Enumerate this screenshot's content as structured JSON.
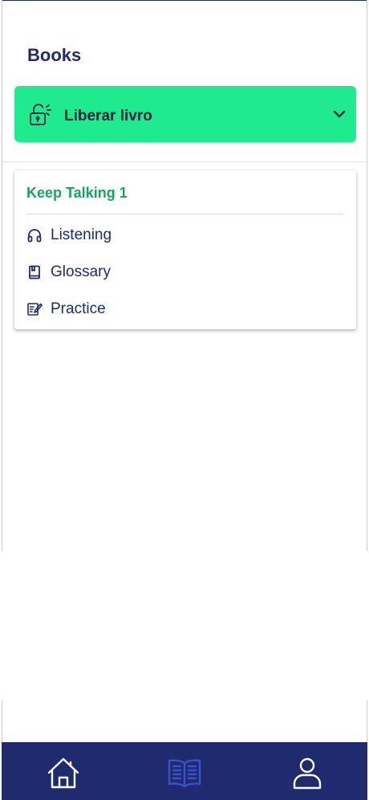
{
  "page": {
    "title": "Books"
  },
  "unlock": {
    "label": "Liberar livro",
    "icon": "unlock-icon",
    "expand_icon": "chevron-down-icon",
    "background": "#1eeb8e"
  },
  "book": {
    "title": "Keep Talking 1",
    "title_color": "#14a85e",
    "items": [
      {
        "label": "Listening",
        "icon": "headphones-icon"
      },
      {
        "label": "Glossary",
        "icon": "book-icon"
      },
      {
        "label": "Practice",
        "icon": "edit-icon"
      }
    ]
  },
  "bottom_nav": {
    "background": "#1f2b6e",
    "items": [
      {
        "name": "home",
        "icon": "home-icon",
        "active": false
      },
      {
        "name": "books",
        "icon": "open-book-icon",
        "active": true
      },
      {
        "name": "profile",
        "icon": "user-icon",
        "active": false
      }
    ],
    "active_color": "#3a52c9",
    "inactive_color": "#ffffff"
  }
}
